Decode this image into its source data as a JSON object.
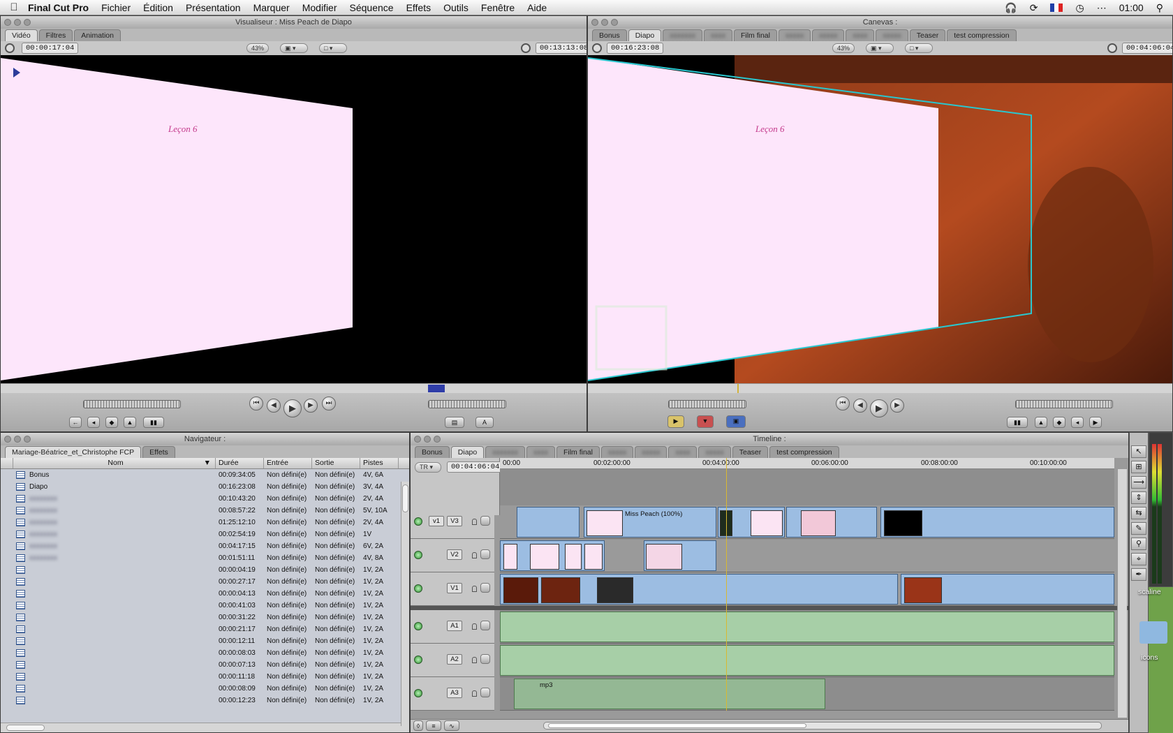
{
  "menubar": {
    "app": "Final Cut Pro",
    "items": [
      "Fichier",
      "Édition",
      "Présentation",
      "Marquer",
      "Modifier",
      "Séquence",
      "Effets",
      "Outils",
      "Fenêtre",
      "Aide"
    ],
    "clock": "01:00"
  },
  "viewer": {
    "title": "Visualiseur : Miss Peach de Diapo",
    "tabs": [
      "Vidéo",
      "Filtres",
      "Animation"
    ],
    "timecode_left": "00:00:17:04",
    "timecode_right": "00:13:13:08",
    "zoom": "43%",
    "slide_text": "Leçon 6"
  },
  "canvas": {
    "title": "Canevas :",
    "tabs": [
      "Bonus",
      "Diapo",
      "",
      "",
      "Film final",
      "",
      "",
      "",
      "",
      "Teaser",
      "test compression"
    ],
    "timecode_left": "00:16:23:08",
    "timecode_right": "00:04:06:04",
    "zoom": "43%",
    "slide_text": "Leçon 6"
  },
  "browser": {
    "title": "Navigateur :",
    "tabs": [
      "Mariage-Béatrice_et_Christophe FCP",
      "Effets"
    ],
    "columns": [
      "Nom",
      "Durée",
      "Entrée",
      "Sortie",
      "Pistes"
    ],
    "rows": [
      {
        "name": "Bonus",
        "dur": "00:09:34:05",
        "in": "Non défini(e)",
        "out": "Non défini(e)",
        "tracks": "4V, 6A",
        "blur": false
      },
      {
        "name": "Diapo",
        "dur": "00:16:23:08",
        "in": "Non défini(e)",
        "out": "Non défini(e)",
        "tracks": "3V, 4A",
        "blur": false
      },
      {
        "name": "",
        "dur": "00:10:43:20",
        "in": "Non défini(e)",
        "out": "Non défini(e)",
        "tracks": "2V, 4A",
        "blur": true
      },
      {
        "name": "",
        "dur": "00:08:57:22",
        "in": "Non défini(e)",
        "out": "Non défini(e)",
        "tracks": "5V, 10A",
        "blur": true
      },
      {
        "name": "",
        "dur": "01:25:12:10",
        "in": "Non défini(e)",
        "out": "Non défini(e)",
        "tracks": "2V, 4A",
        "blur": true
      },
      {
        "name": "",
        "dur": "00:02:54:19",
        "in": "Non défini(e)",
        "out": "Non défini(e)",
        "tracks": "1V",
        "blur": true
      },
      {
        "name": "",
        "dur": "00:04:17:15",
        "in": "Non défini(e)",
        "out": "Non défini(e)",
        "tracks": "6V, 2A",
        "blur": true
      },
      {
        "name": "",
        "dur": "00:01:51:11",
        "in": "Non défini(e)",
        "out": "Non défini(e)",
        "tracks": "4V, 8A",
        "blur": true
      },
      {
        "name": "",
        "dur": "00:00:04:19",
        "in": "Non défini(e)",
        "out": "Non défini(e)",
        "tracks": "1V, 2A",
        "blur": false
      },
      {
        "name": "",
        "dur": "00:00:27:17",
        "in": "Non défini(e)",
        "out": "Non défini(e)",
        "tracks": "1V, 2A",
        "blur": false
      },
      {
        "name": "",
        "dur": "00:00:04:13",
        "in": "Non défini(e)",
        "out": "Non défini(e)",
        "tracks": "1V, 2A",
        "blur": false
      },
      {
        "name": "",
        "dur": "00:00:41:03",
        "in": "Non défini(e)",
        "out": "Non défini(e)",
        "tracks": "1V, 2A",
        "blur": false
      },
      {
        "name": "",
        "dur": "00:00:31:22",
        "in": "Non défini(e)",
        "out": "Non défini(e)",
        "tracks": "1V, 2A",
        "blur": false
      },
      {
        "name": "",
        "dur": "00:00:21:17",
        "in": "Non défini(e)",
        "out": "Non défini(e)",
        "tracks": "1V, 2A",
        "blur": false
      },
      {
        "name": "",
        "dur": "00:00:12:11",
        "in": "Non défini(e)",
        "out": "Non défini(e)",
        "tracks": "1V, 2A",
        "blur": false
      },
      {
        "name": "",
        "dur": "00:00:08:03",
        "in": "Non défini(e)",
        "out": "Non défini(e)",
        "tracks": "1V, 2A",
        "blur": false
      },
      {
        "name": "",
        "dur": "00:00:07:13",
        "in": "Non défini(e)",
        "out": "Non défini(e)",
        "tracks": "1V, 2A",
        "blur": false
      },
      {
        "name": "",
        "dur": "00:00:11:18",
        "in": "Non défini(e)",
        "out": "Non défini(e)",
        "tracks": "1V, 2A",
        "blur": false
      },
      {
        "name": "",
        "dur": "00:00:08:09",
        "in": "Non défini(e)",
        "out": "Non défini(e)",
        "tracks": "1V, 2A",
        "blur": false
      },
      {
        "name": "",
        "dur": "00:00:12:23",
        "in": "Non défini(e)",
        "out": "Non défini(e)",
        "tracks": "1V, 2A",
        "blur": false
      }
    ]
  },
  "timeline": {
    "title": "Timeline :",
    "tabs": [
      "Bonus",
      "Diapo",
      "",
      "",
      "Film final",
      "",
      "",
      "",
      "",
      "Teaser",
      "test compression"
    ],
    "rt_label": "TR",
    "timecode": "00:04:06:04",
    "ruler": [
      "00:00",
      "00:02:00:00",
      "00:04:00:00",
      "00:06:00:00",
      "00:08:00:00",
      "00:10:00:00"
    ],
    "tracks": {
      "video": [
        {
          "src": "v1",
          "dst": "V3"
        },
        {
          "dst": "V2"
        },
        {
          "dst": "V1"
        }
      ],
      "audio": [
        {
          "dst": "A1"
        },
        {
          "dst": "A2"
        },
        {
          "dst": "A3"
        }
      ]
    },
    "clip_label_v3": "Miss Peach (100%)",
    "clip_label_a3": "mp3"
  },
  "desktop": {
    "icon_labels": [
      "scaline",
      "icons"
    ]
  },
  "colors": {
    "video_clip": "#9cbde2",
    "audio_clip": "#a7cfa7",
    "slide_pink": "#fde6fb",
    "overlay_cyan": "#29c7cf"
  }
}
